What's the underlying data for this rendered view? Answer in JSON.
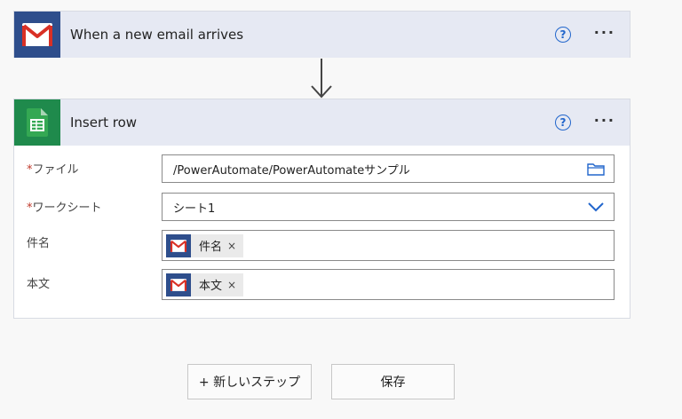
{
  "trigger": {
    "title": "When a new email arrives",
    "help_label": "?",
    "more_label": "···"
  },
  "action": {
    "title": "Insert row",
    "help_label": "?",
    "more_label": "···",
    "fields": {
      "file": {
        "required_mark": "*",
        "label": "ファイル",
        "value": "/PowerAutomate/PowerAutomateサンプル"
      },
      "worksheet": {
        "required_mark": "*",
        "label": "ワークシート",
        "value": "シート1"
      },
      "subject": {
        "label": "件名",
        "token_label": "件名",
        "token_close": "×"
      },
      "body": {
        "label": "本文",
        "token_label": "本文",
        "token_close": "×"
      }
    }
  },
  "buttons": {
    "new_step": "+ 新しいステップ",
    "save": "保存"
  },
  "colors": {
    "header_bg": "#e6e9f3",
    "gmail_tile": "#2e4e8c",
    "sheets_tile": "#1f8a4c",
    "accent_blue": "#2266cc",
    "required_red": "#c0392b"
  }
}
